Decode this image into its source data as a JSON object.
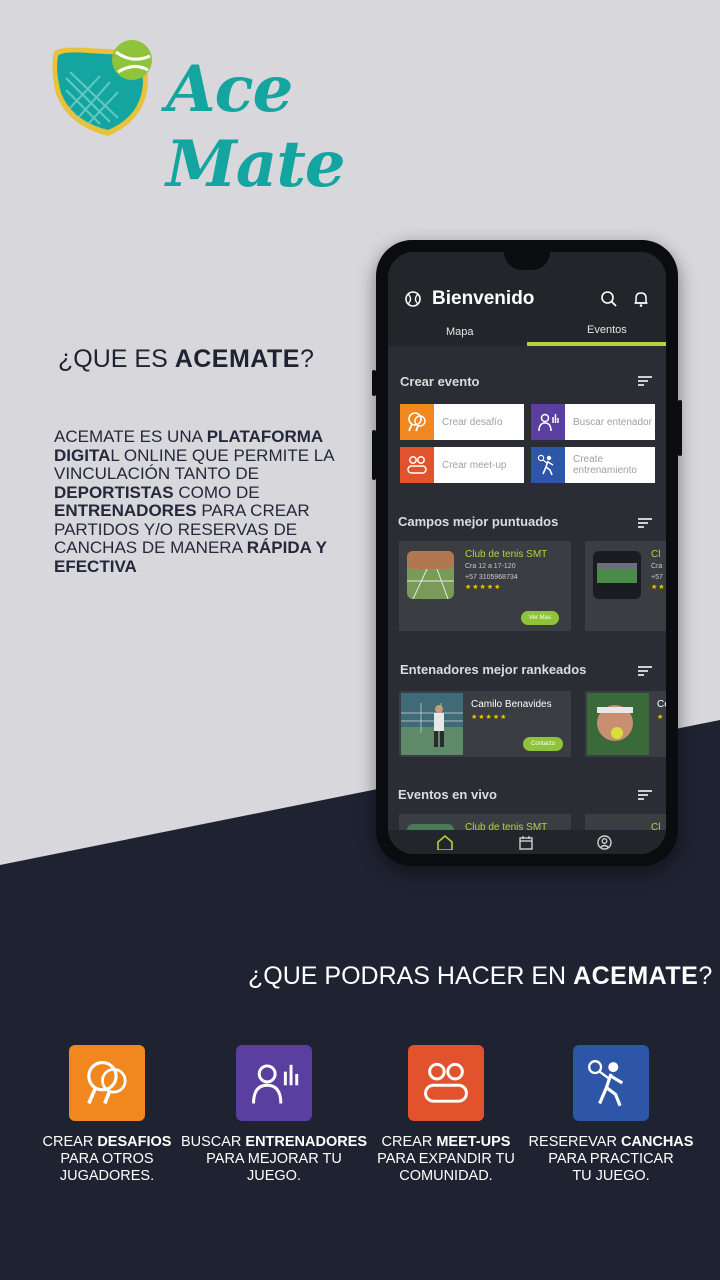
{
  "brand": {
    "name": "Ace Mate",
    "teal": "#14a5a1",
    "green": "#8fc43a",
    "dark_bg": "#1f2230",
    "light_bg": "#d8d7dc"
  },
  "intro": {
    "question_prefix": "¿QUE ES ",
    "question_brand": "ACEMATE",
    "question_suffix": "?",
    "description": [
      {
        "t": "ACEMATE ES UNA ",
        "b": false
      },
      {
        "t": "PLATAFORMA DIGITA",
        "b": true
      },
      {
        "t": "L ONLINE QUE PERMITE LA VINCULACIÓN  TANTO DE ",
        "b": false
      },
      {
        "t": "DEPORTISTAS",
        "b": true
      },
      {
        "t": " COMO DE ",
        "b": false
      },
      {
        "t": "ENTRENADORES",
        "b": true
      },
      {
        "t": " PARA CREAR PARTIDOS Y/O RESERVAS DE CANCHAS DE MANERA ",
        "b": false
      },
      {
        "t": "RÁPIDA Y EFECTIVA",
        "b": true
      }
    ]
  },
  "app": {
    "title": "Bienvenido",
    "tabs": [
      "Mapa",
      "Eventos"
    ],
    "active_tab": "Eventos",
    "sections": {
      "create": "Crear evento",
      "fields": "Campos mejor puntuados",
      "coaches": "Entenadores mejor rankeados",
      "live": "Eventos en vivo"
    },
    "event_buttons": [
      {
        "label": "Crear desafío",
        "color": "#f0871f",
        "icon": "rackets-icon"
      },
      {
        "label": "Buscar entenador",
        "color": "#5a3fa0",
        "icon": "coach-icon"
      },
      {
        "label": "Crear meet-up",
        "color": "#e2532d",
        "icon": "group-icon"
      },
      {
        "label": "Create entrenamiento",
        "color": "#2d55a8",
        "icon": "player-icon"
      }
    ],
    "field_card": {
      "name": "Club de tenis SMT",
      "address": "Cra 12 a 17-120",
      "phone": "+57 3105968734",
      "stars": "★★★★★",
      "action": "Ver Mas"
    },
    "peek_card": {
      "name": "Cl",
      "line1": "Cra",
      "line2": "+57",
      "stars": "★★"
    },
    "coach_card": {
      "name": "Camilo Benavides",
      "stars": "★★★★★",
      "action": "Contacto"
    },
    "peek_coach": {
      "name": "Ce",
      "stars": "★"
    },
    "live_card": {
      "name": "Club de tenis SMT",
      "peek": "Cl"
    }
  },
  "features": {
    "question_prefix": "¿QUE PODRAS HACER EN ",
    "question_brand": "ACEMATE",
    "question_suffix": "?",
    "items": [
      {
        "pre": "CREAR ",
        "bold": "DESAFIOS",
        "rest": "PARA OTROS JUGADORES.",
        "color": "#f0871f"
      },
      {
        "pre": "BUSCAR ",
        "bold": "ENTRENADORES",
        "rest": "PARA MEJORAR TU JUEGO.",
        "color": "#5a3fa0"
      },
      {
        "pre": "CREAR ",
        "bold": "MEET-UPS",
        "rest": "PARA EXPANDIR TU COMUNIDAD.",
        "color": "#e2532d"
      },
      {
        "pre": "RESEREVAR ",
        "bold": "CANCHAS",
        "rest": "PARA PRACTICAR TU JUEGO.",
        "color": "#2d55a8"
      }
    ]
  }
}
